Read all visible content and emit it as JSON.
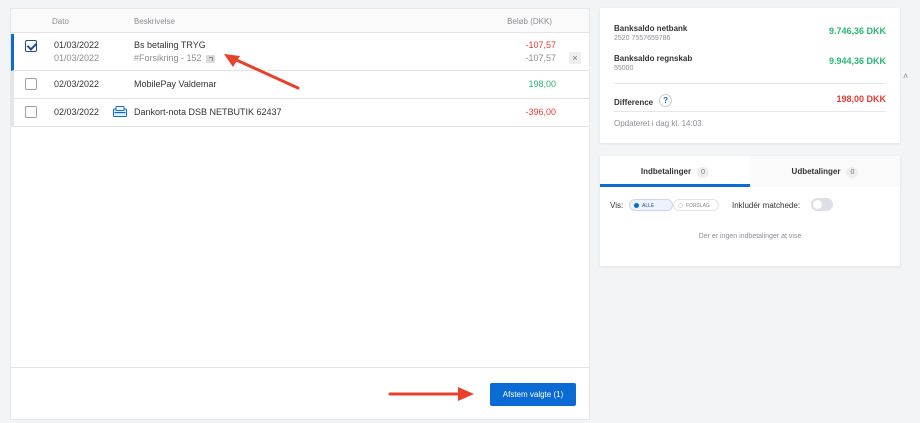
{
  "table": {
    "headers": {
      "date": "Dato",
      "description": "Beskrivelse",
      "amount": "Beløb (DKK)"
    },
    "rows": [
      {
        "checked": true,
        "date": "01/03/2022",
        "sub_date": "01/03/2022",
        "description": "Bs betaling TRYG",
        "sub_description": "#Forsikring - 152",
        "amount": "-107,57",
        "sub_amount": "-107,57"
      },
      {
        "checked": false,
        "date": "02/03/2022",
        "description": "MobilePay Valdemar",
        "amount": "198,00"
      },
      {
        "checked": false,
        "date": "02/03/2022",
        "description": "Dankort-nota DSB NETBUTIK 62437",
        "amount": "-396,00",
        "icon": "card-icon"
      }
    ]
  },
  "footer": {
    "reconcile_button": "Afstem valgte (1)"
  },
  "saldo": {
    "bank": {
      "label": "Banksaldo netbank",
      "account": "2520 7557659786",
      "value": "9.746,36 DKK"
    },
    "ledger": {
      "label": "Banksaldo regnskab",
      "account": "55000",
      "value": "9.944,36 DKK"
    },
    "difference": {
      "label": "Difference",
      "help": "?",
      "value": "198,00 DKK"
    },
    "updated": "Opdateret i dag kl. 14:03."
  },
  "transactions": {
    "tabs": [
      {
        "label": "Indbetalinger",
        "count": "0"
      },
      {
        "label": "Udbetalinger",
        "count": "0"
      }
    ],
    "filter": {
      "label": "Vis:",
      "options": [
        "ALLE",
        "FORSLAG"
      ],
      "selected": "ALLE"
    },
    "include_matched": "Inkludér matchede:",
    "empty_message": "Der er ingen indbetalinger at vise"
  },
  "colors": {
    "accent": "#0b6bd4",
    "positive": "#2bb673",
    "negative": "#e53935",
    "annotation_arrow": "#e8412b"
  }
}
